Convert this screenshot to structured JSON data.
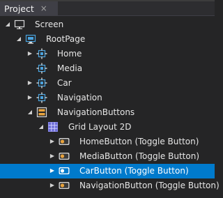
{
  "panel": {
    "tab_label": "Project",
    "close_symbol": "×"
  },
  "tree": {
    "items": [
      {
        "label": "Screen",
        "icon": "monitor-icon",
        "expander": "expanded"
      },
      {
        "label": "RootPage",
        "icon": "page-icon",
        "expander": "expanded"
      },
      {
        "label": "Home",
        "icon": "page-component-icon",
        "expander": "collapsed"
      },
      {
        "label": "Media",
        "icon": "page-component-icon",
        "expander": "none"
      },
      {
        "label": "Car",
        "icon": "page-component-icon",
        "expander": "collapsed"
      },
      {
        "label": "Navigation",
        "icon": "page-component-icon",
        "expander": "collapsed"
      },
      {
        "label": "NavigationButtons",
        "icon": "stack-layout-icon",
        "expander": "expanded"
      },
      {
        "label": "Grid Layout 2D",
        "icon": "grid-layout-icon",
        "expander": "expanded"
      },
      {
        "label": "HomeButton (Toggle Button)",
        "icon": "toggle-button-icon",
        "expander": "collapsed"
      },
      {
        "label": "MediaButton (Toggle Button)",
        "icon": "toggle-button-icon",
        "expander": "collapsed"
      },
      {
        "label": "CarButton (Toggle Button)",
        "icon": "toggle-button-icon",
        "expander": "collapsed",
        "selected": true
      },
      {
        "label": "NavigationButton (Toggle Button)",
        "icon": "toggle-button-icon",
        "expander": "collapsed"
      }
    ]
  },
  "colors": {
    "background": "#252526",
    "selection": "#007acc",
    "text": "#e6e6e6",
    "icon_blue": "#4aa3df",
    "icon_orange": "#e8a33d"
  }
}
